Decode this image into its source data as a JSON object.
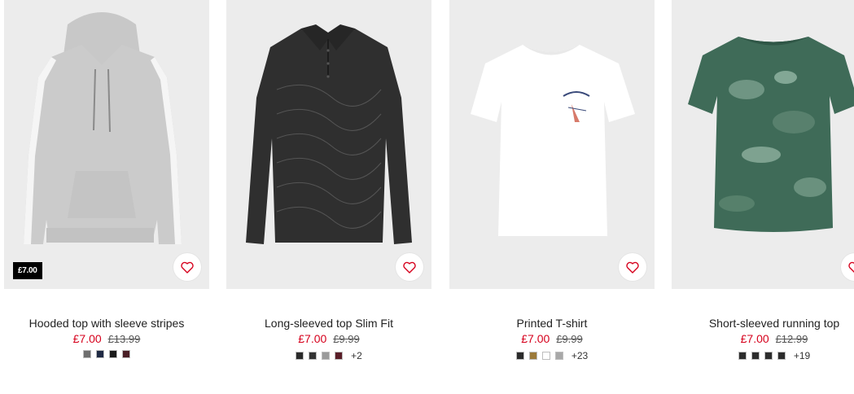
{
  "products": [
    {
      "title": "Hooded top with sleeve stripes",
      "price": "£7.00",
      "old_price": "£13.99",
      "badge": "£7.00",
      "swatches": [
        "#6f6f6f",
        "#1f2a44",
        "#1b1b1b",
        "#4a1f26"
      ],
      "more": ""
    },
    {
      "title": "Long-sleeved top Slim Fit",
      "price": "£7.00",
      "old_price": "£9.99",
      "badge": "",
      "swatches": [
        "#2a2a2a",
        "#333333",
        "#9a9a9a",
        "#5a1e28"
      ],
      "more": "+2"
    },
    {
      "title": "Printed T-shirt",
      "price": "£7.00",
      "old_price": "£9.99",
      "badge": "",
      "swatches": [
        "#2b2b2b",
        "#9c7a3a",
        "#ffffff",
        "#a8a8a8"
      ],
      "more": "+23"
    },
    {
      "title": "Short-sleeved running top",
      "price": "£7.00",
      "old_price": "£12.99",
      "badge": "",
      "swatches": [
        "#2c2c2c",
        "#2c2c2c",
        "#2c2c2c",
        "#2c2c2c"
      ],
      "more": "+19"
    }
  ],
  "colors": {
    "sale_price": "#d6001c",
    "image_background": "#ebebeb"
  },
  "icons": {
    "favorite": "heart-icon"
  }
}
